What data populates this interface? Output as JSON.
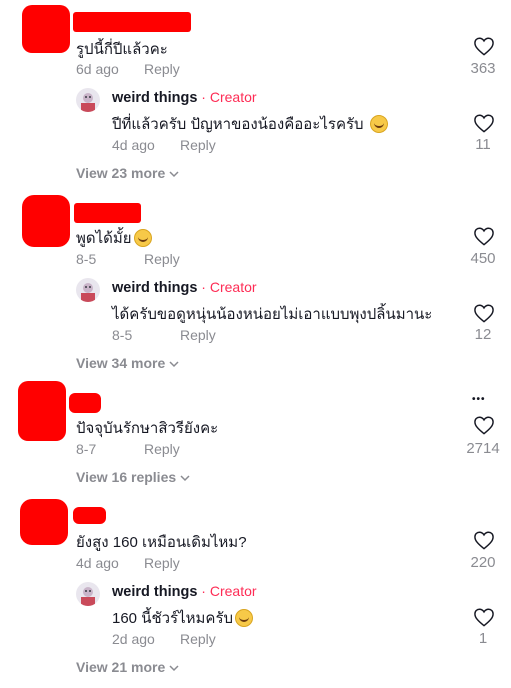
{
  "c1": {
    "text": "รูปนี้กี่ปีแล้วคะ",
    "date": "6d ago",
    "reply": "Reply",
    "likes": "363",
    "sub": {
      "name": "weird things",
      "creator": " · Creator",
      "text": "ปีที่แล้วครับ ปัญหาของน้องคืออะไรครับ",
      "date": "4d ago",
      "reply": "Reply",
      "likes": "11"
    },
    "view_more": "View 23 more"
  },
  "c2": {
    "text": "พูดได้มั้ย",
    "date": "8-5",
    "reply": "Reply",
    "likes": "450",
    "sub": {
      "name": "weird things",
      "creator": " · Creator",
      "text": "ได้ครับขอดูหนุ่นน้องหน่อยไม่เอาแบบพุงปลิ้นมานะ",
      "date": "8-5",
      "reply": "Reply",
      "likes": "12"
    },
    "view_more": "View 34 more"
  },
  "c3": {
    "text": "ปัจจุบันรักษาสิวรียังคะ",
    "date": "8-7",
    "reply": "Reply",
    "likes": "2714",
    "more_dots": "•••",
    "view_more": "View 16 replies"
  },
  "c4": {
    "text": "ยังสูง 160 เหมือนเดิมไหม?",
    "date": "4d ago",
    "reply": "Reply",
    "likes": "220",
    "sub": {
      "name": "weird things",
      "creator": " · Creator",
      "text": "160 นี้ชัวร์ไหมครับ",
      "date": "2d ago",
      "reply": "Reply",
      "likes": "1"
    },
    "view_more": "View 21 more"
  },
  "colors": {
    "redaction": "#ff0000",
    "creator": "#fe2c55",
    "muted": "#8a8b91",
    "text": "#161823"
  }
}
